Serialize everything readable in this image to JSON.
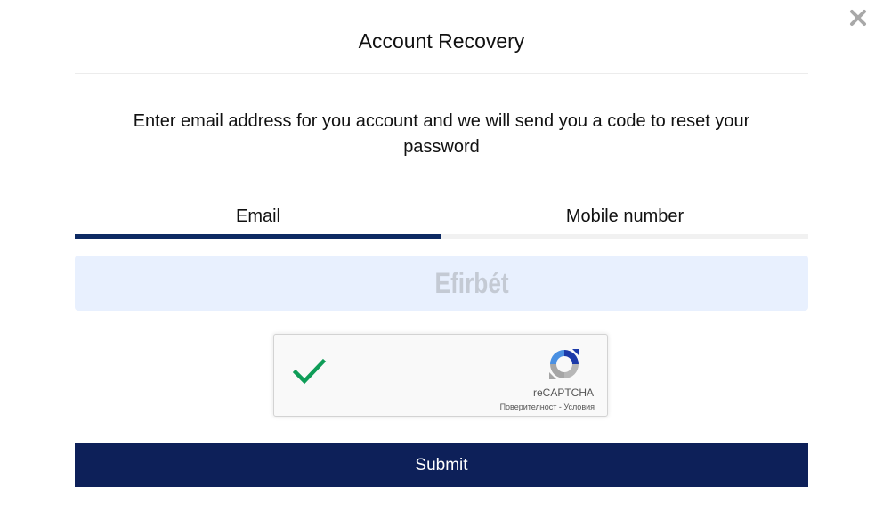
{
  "dialog": {
    "title": "Account Recovery",
    "instruction": "Enter email address for you account and we will send you a code to reset your password"
  },
  "tabs": [
    {
      "label": "Email",
      "active": true
    },
    {
      "label": "Mobile number",
      "active": false
    }
  ],
  "brand": {
    "text": "Efirbét"
  },
  "recaptcha": {
    "checked": true,
    "label": "reCAPTCHA",
    "privacy_link": "Поверителност",
    "separator": " - ",
    "terms_link": "Условия"
  },
  "submit": {
    "label": "Submit"
  },
  "colors": {
    "primary": "#0d2059",
    "tab_active": "#0d2a63",
    "check_green": "#0f9d58",
    "brand_box": "#e8f0fe"
  },
  "icons": {
    "close": "close-icon",
    "check": "check-icon",
    "recaptcha": "recaptcha-logo-icon"
  }
}
